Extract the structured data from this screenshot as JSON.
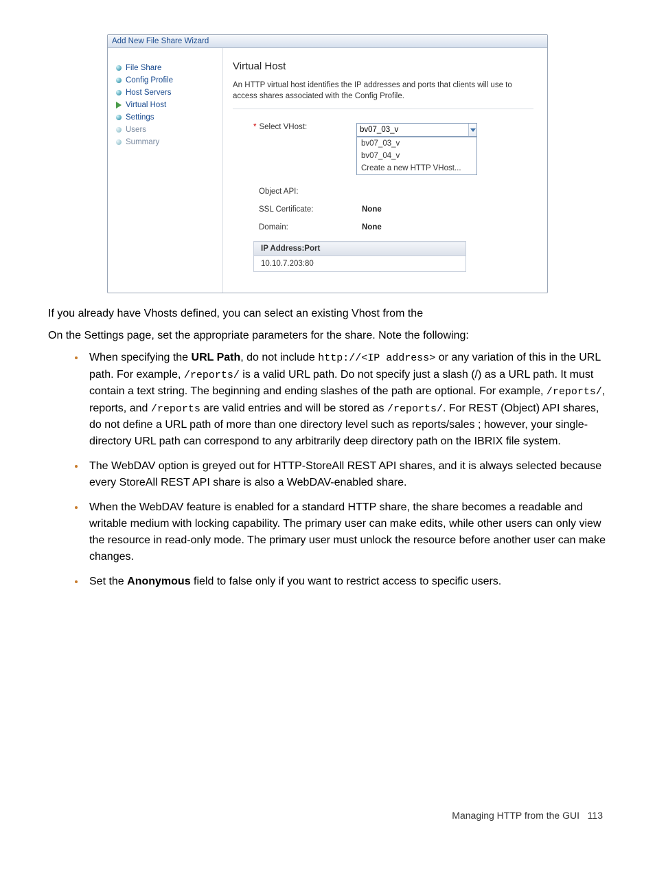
{
  "wizard": {
    "title": "Add New File Share Wizard",
    "steps": [
      {
        "label": "File Share",
        "state": "done"
      },
      {
        "label": "Config Profile",
        "state": "done"
      },
      {
        "label": "Host Servers",
        "state": "done"
      },
      {
        "label": "Virtual Host",
        "state": "current"
      },
      {
        "label": "Settings",
        "state": "done"
      },
      {
        "label": "Users",
        "state": "pending"
      },
      {
        "label": "Summary",
        "state": "pending"
      }
    ],
    "heading": "Virtual Host",
    "description": "An HTTP virtual host identifies the IP addresses and ports that clients will use to access shares associated with the Config Profile.",
    "fields": {
      "select_vhost_label": "Select VHost:",
      "select_vhost_value": "bv07_03_v",
      "dropdown_options": [
        "bv07_03_v",
        "bv07_04_v",
        "Create a new HTTP VHost..."
      ],
      "object_api_label": "Object API:",
      "ssl_label": "SSL Certificate:",
      "ssl_value": "None",
      "domain_label": "Domain:",
      "domain_value": "None",
      "ip_header": "IP Address:Port",
      "ip_rows": [
        "10.10.7.203:80"
      ]
    }
  },
  "body": {
    "p1": "If you already have Vhosts defined, you can select an existing Vhost from the",
    "p2": "On the Settings page, set the appropriate parameters for the share. Note the following:",
    "li1_a": "When specifying the ",
    "li1_b": "URL Path",
    "li1_c": ", do not include ",
    "li1_d": "http://<IP address>",
    "li1_e": " or any variation of this in the URL path. For example, ",
    "li1_f": "/reports/",
    "li1_g": " is a valid URL path. Do not specify just a slash (/) as a URL path. It must contain a text string. The beginning and ending slashes of the path are optional. For example, ",
    "li1_h": "/reports/",
    "li1_i": ", reports, and ",
    "li1_j": "/reports",
    "li1_k": " are valid entries and will be stored as ",
    "li1_l": "/reports/",
    "li1_m": ". For REST (Object) API shares, do not define a URL path of more than one directory level such as reports/sales ; however, your single-directory URL path can correspond to any arbitrarily deep directory path on the IBRIX file system.",
    "li2": "The WebDAV option is greyed out for HTTP-StoreAll REST API shares, and it is always selected because every StoreAll REST API share is also a WebDAV-enabled share.",
    "li3": "When the WebDAV feature is enabled for a standard HTTP share, the share becomes a readable and writable medium with locking capability. The primary user can make edits, while other users can only view the resource in read-only mode. The primary user must unlock the resource before another user can make changes.",
    "li4_a": "Set the ",
    "li4_b": "Anonymous",
    "li4_c": " field to false only if you want to restrict access to specific users."
  },
  "footer": {
    "section": "Managing HTTP from the GUI",
    "page": "113"
  }
}
